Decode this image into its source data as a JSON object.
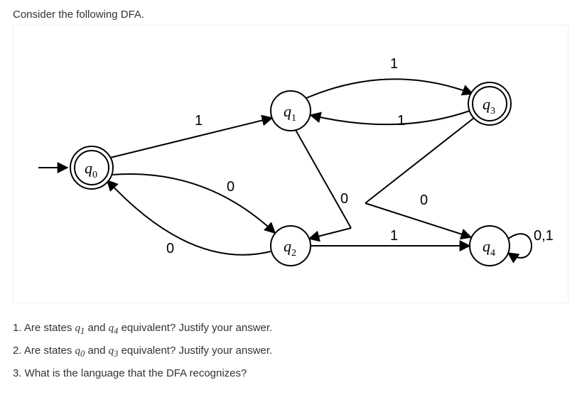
{
  "intro": "Consider the following DFA.",
  "states": {
    "q0": "q",
    "q0_sub": "0",
    "q1": "q",
    "q1_sub": "1",
    "q2": "q",
    "q2_sub": "2",
    "q3": "q",
    "q3_sub": "3",
    "q4": "q",
    "q4_sub": "4"
  },
  "edges": {
    "q0_q1": "1",
    "q0_q2": "0",
    "q1_q3": "1",
    "q1_q2_0": "0",
    "q2_q0": "0",
    "q2_q4": "1",
    "q3_q1": "1",
    "q3_q4": "0",
    "q4_loop": "0,1"
  },
  "questions": {
    "q1_a": "1. Are states ",
    "q1_sym1": "q",
    "q1_sub1": "1",
    "q1_mid": " and ",
    "q1_sym2": "q",
    "q1_sub2": "4",
    "q1_b": " equivalent? Justify your answer.",
    "q2_a": "2. Are states ",
    "q2_sym1": "q",
    "q2_sub1": "0",
    "q2_mid": " and ",
    "q2_sym2": "q",
    "q2_sub2": "3",
    "q2_b": " equivalent? Justify your answer.",
    "q3": "3. What is the language that the DFA recognizes?"
  },
  "chart_data": {
    "type": "state-diagram",
    "title": "DFA",
    "states": [
      {
        "id": "q0",
        "initial": true,
        "accepting": true
      },
      {
        "id": "q1",
        "initial": false,
        "accepting": false
      },
      {
        "id": "q2",
        "initial": false,
        "accepting": false
      },
      {
        "id": "q3",
        "initial": false,
        "accepting": true
      },
      {
        "id": "q4",
        "initial": false,
        "accepting": false
      }
    ],
    "transitions": [
      {
        "from": "q0",
        "to": "q1",
        "label": "1"
      },
      {
        "from": "q0",
        "to": "q2",
        "label": "0"
      },
      {
        "from": "q1",
        "to": "q3",
        "label": "1"
      },
      {
        "from": "q1",
        "to": "q2",
        "label": "0"
      },
      {
        "from": "q2",
        "to": "q0",
        "label": "0"
      },
      {
        "from": "q2",
        "to": "q4",
        "label": "1"
      },
      {
        "from": "q3",
        "to": "q1",
        "label": "1"
      },
      {
        "from": "q3",
        "to": "q4",
        "label": "0"
      },
      {
        "from": "q4",
        "to": "q4",
        "label": "0,1"
      }
    ]
  }
}
